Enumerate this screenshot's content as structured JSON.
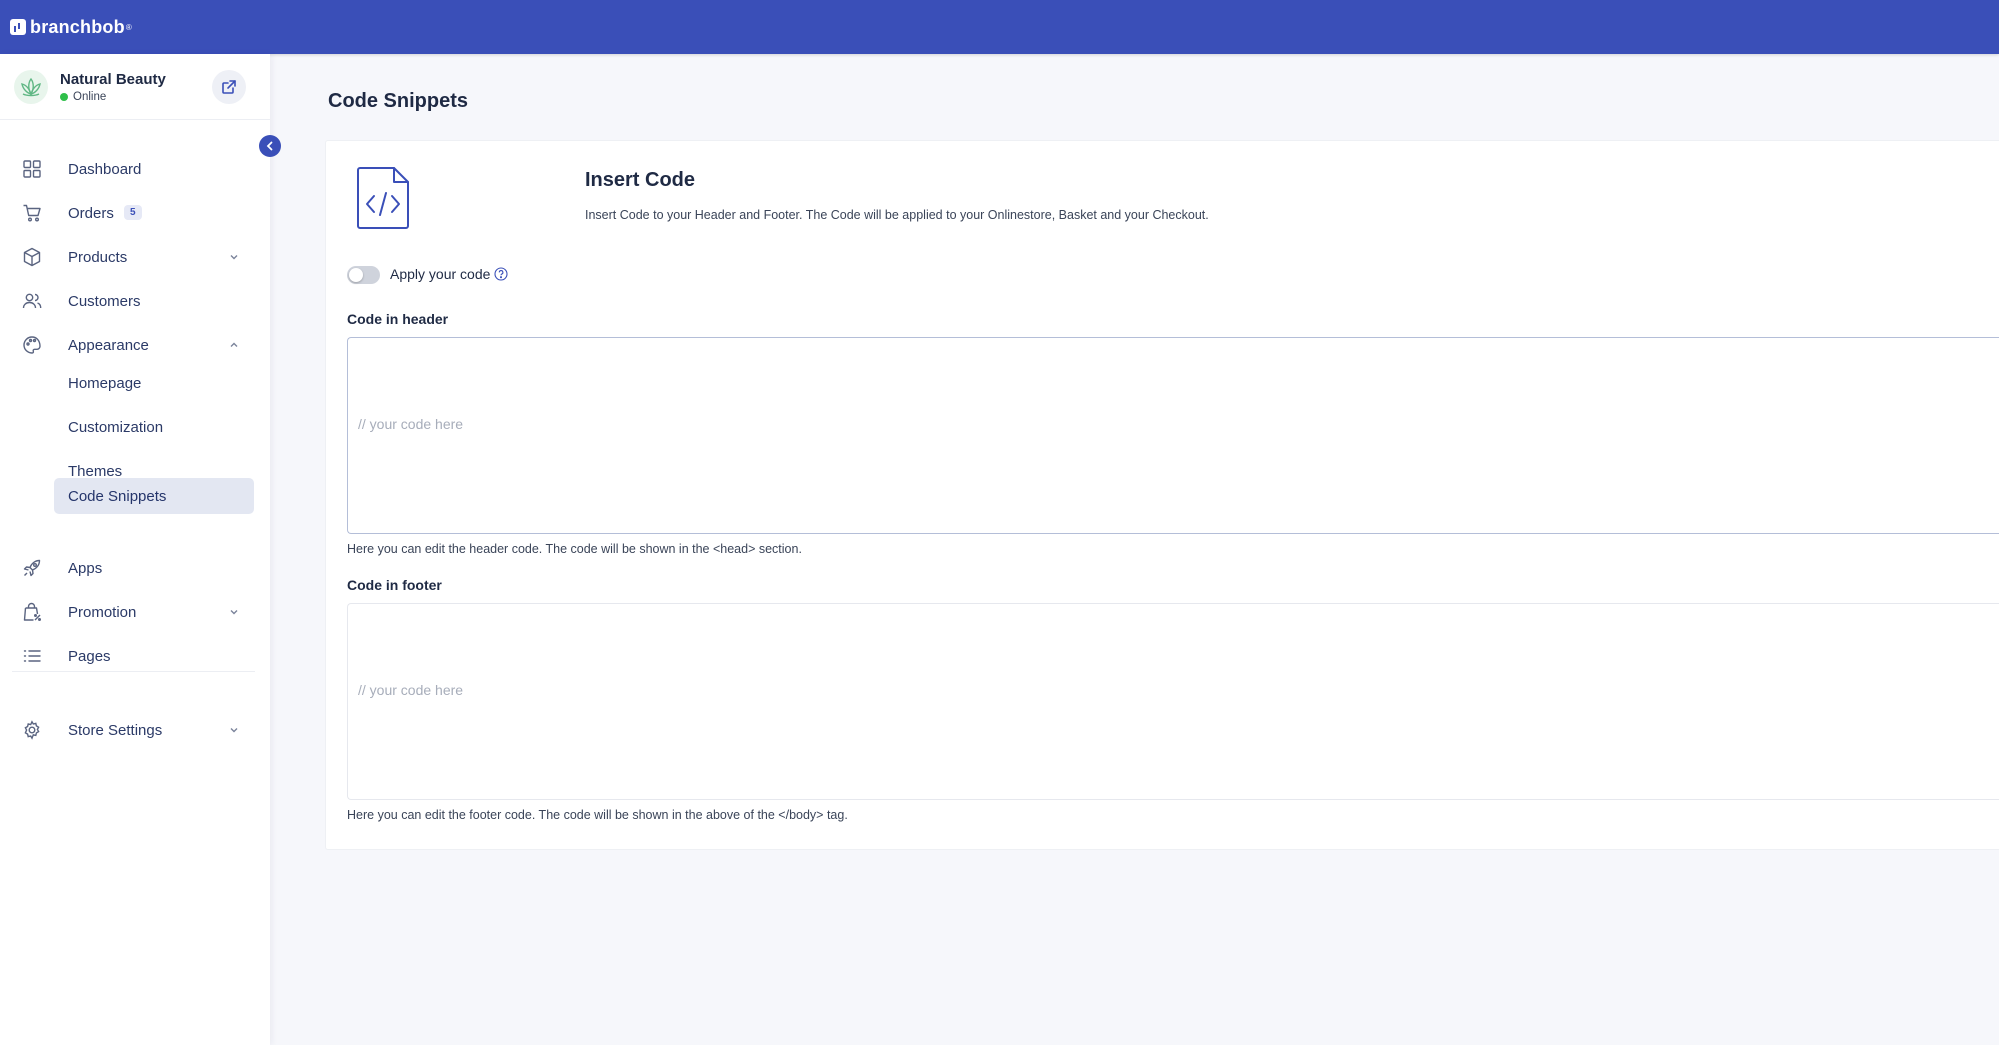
{
  "brand": {
    "name": "branchbob",
    "reg": "®"
  },
  "store": {
    "name": "Natural Beauty",
    "status": "Online"
  },
  "nav": {
    "dashboard": "Dashboard",
    "orders": "Orders",
    "orders_badge": "5",
    "products": "Products",
    "customers": "Customers",
    "appearance": "Appearance",
    "appearance_sub": [
      "Homepage",
      "Customization",
      "Themes",
      "Code Snippets"
    ],
    "apps": "Apps",
    "promotion": "Promotion",
    "pages": "Pages",
    "store_settings": "Store Settings"
  },
  "page": {
    "title": "Code Snippets",
    "card": {
      "title": "Insert Code",
      "description": "Insert Code to your Header and Footer. The Code will be applied to your Onlinestore, Basket and your Checkout.",
      "toggle_label": "Apply your code",
      "header_label": "Code in header",
      "header_placeholder": "// your code here",
      "header_help": "Here you can edit the header code. The code will be shown in the <head> section.",
      "footer_label": "Code in footer",
      "footer_placeholder": "// your code here",
      "footer_help": "Here you can edit the footer code. The code will be shown in the above of the </body> tag."
    }
  },
  "colors": {
    "primary": "#3a4fb8",
    "online": "#2fbf4a",
    "active_bg": "#e3e7f2"
  }
}
